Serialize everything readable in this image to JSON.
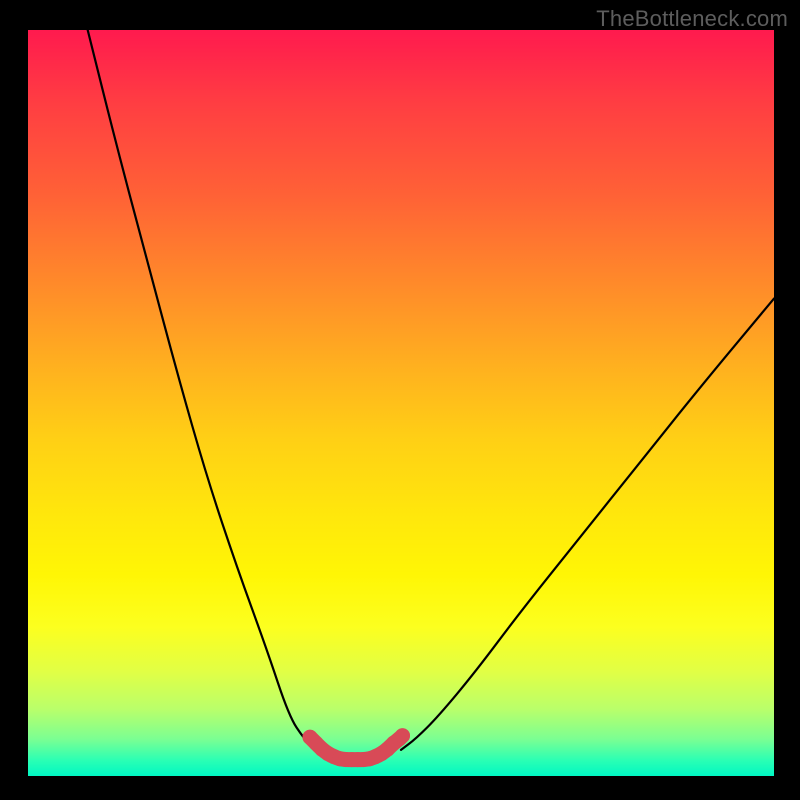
{
  "watermark": "TheBottleneck.com",
  "chart_data": {
    "type": "line",
    "title": "",
    "xlabel": "",
    "ylabel": "",
    "xlim": [
      0,
      100
    ],
    "ylim": [
      0,
      100
    ],
    "series": [
      {
        "name": "left-branch-curve",
        "x": [
          8,
          12,
          16,
          20,
          24,
          28,
          32,
          35,
          37,
          38.5
        ],
        "y": [
          100,
          84,
          69,
          54,
          40,
          28,
          17,
          8,
          5,
          3.5
        ]
      },
      {
        "name": "right-branch-curve",
        "x": [
          50,
          52,
          55,
          60,
          66,
          74,
          82,
          90,
          100
        ],
        "y": [
          3.5,
          5,
          8,
          14,
          22,
          32,
          42,
          52,
          64
        ]
      },
      {
        "name": "basin-dots",
        "x": [
          37.8,
          38.6,
          39.4,
          40.2,
          41.0,
          41.8,
          42.6,
          43.4,
          44.2,
          45.0,
          45.8,
          46.6,
          47.4,
          48.2,
          49.0,
          49.8,
          50.2
        ],
        "y": [
          5.2,
          4.4,
          3.6,
          3.0,
          2.6,
          2.3,
          2.2,
          2.2,
          2.2,
          2.2,
          2.3,
          2.6,
          3.0,
          3.6,
          4.4,
          5.0,
          5.4
        ]
      }
    ],
    "colors": {
      "curve": "#000000",
      "dots": "#d84a57"
    }
  }
}
